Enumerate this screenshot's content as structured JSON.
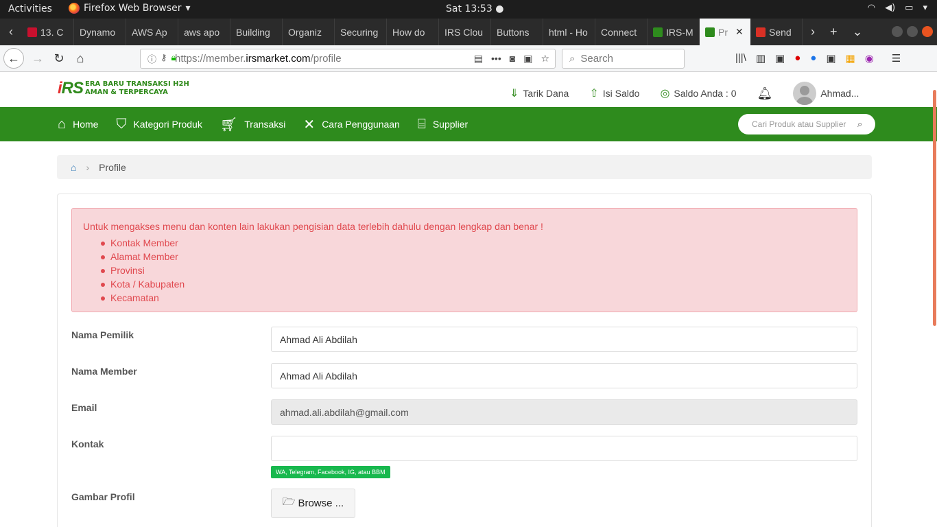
{
  "os": {
    "activities": "Activities",
    "app_name": "Firefox Web Browser",
    "clock": "Sat 13:53 ●"
  },
  "tabs": [
    {
      "label": "13. C",
      "fav_color": "#c8102e"
    },
    {
      "label": "Dynamo",
      "fav_color": ""
    },
    {
      "label": "AWS Ap",
      "fav_color": ""
    },
    {
      "label": "aws apo",
      "fav_color": ""
    },
    {
      "label": "Building",
      "fav_color": ""
    },
    {
      "label": "Organiz",
      "fav_color": ""
    },
    {
      "label": "Securing",
      "fav_color": ""
    },
    {
      "label": "How do",
      "fav_color": ""
    },
    {
      "label": "IRS Clou",
      "fav_color": ""
    },
    {
      "label": "Buttons",
      "fav_color": ""
    },
    {
      "label": "html - Ho",
      "fav_color": ""
    },
    {
      "label": "Connect",
      "fav_color": ""
    },
    {
      "label": "IRS-M",
      "fav_color": "#2e8b1d"
    }
  ],
  "active_tab": {
    "label": "Pr",
    "fav_color": "#2e8b1d"
  },
  "tab_after": {
    "label": "Send",
    "fav_color": "#d93025"
  },
  "browser": {
    "url_prefix": "https://member.",
    "url_domain": "irsmarket.com",
    "url_path": "/profile",
    "search_placeholder": "Search"
  },
  "site": {
    "logo_mark_red": "i",
    "logo_mark_green": "RS",
    "logo_line1": "ERA BARU TRANSAKSI H2H",
    "logo_line2": "AMAN & TERPERCAYA",
    "tarik_dana": "Tarik Dana",
    "isi_saldo": "Isi Saldo",
    "saldo": "Saldo Anda : 0",
    "user": "Ahmad..."
  },
  "menu": {
    "home": "Home",
    "kategori": "Kategori Produk",
    "transaksi": "Transaksi",
    "cara": "Cara Penggunaan",
    "supplier": "Supplier",
    "search_placeholder": "Cari Produk atau Supplier"
  },
  "breadcrumb": {
    "current": "Profile"
  },
  "alert": {
    "message": "Untuk mengakses menu dan konten lain lakukan pengisian data terlebih dahulu dengan lengkap dan benar !",
    "items": [
      "Kontak Member",
      "Alamat Member",
      "Provinsi",
      "Kota / Kabupaten",
      "Kecamatan"
    ]
  },
  "form": {
    "nama_pemilik_label": "Nama Pemilik",
    "nama_pemilik_value": "Ahmad Ali Abdilah",
    "nama_member_label": "Nama Member",
    "nama_member_value": "Ahmad Ali Abdilah",
    "email_label": "Email",
    "email_value": "ahmad.ali.abdilah@gmail.com",
    "kontak_label": "Kontak",
    "kontak_value": "",
    "kontak_hint": "WA, Telegram, Facebook, IG, atau BBM",
    "gambar_label": "Gambar Profil",
    "browse_label": "Browse ..."
  }
}
